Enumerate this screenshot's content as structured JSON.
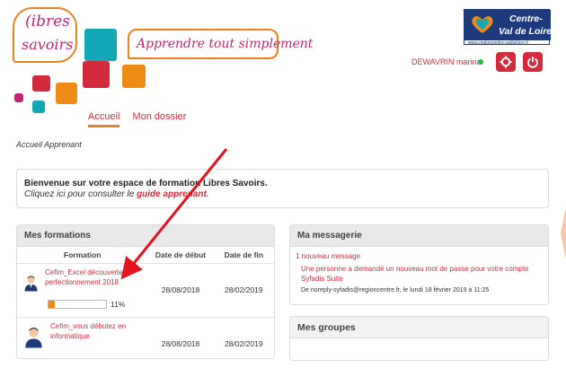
{
  "brand": {
    "logo_line1": "(ibres",
    "logo_line2": "savoirs",
    "tagline": "Apprendre tout simplement",
    "colors": {
      "accent": "#d42b3c",
      "orange": "#e8821e",
      "teal": "#11a7b4",
      "pink": "#c0266f",
      "navy": "#1d3a7a"
    }
  },
  "region_logo": {
    "line1": "Centre-",
    "line2": "Val de Loire",
    "url": "www.regioncentre-valdeloire.fr"
  },
  "nav": {
    "tabs": [
      {
        "label": "Accueil",
        "active": true
      },
      {
        "label": "Mon dossier",
        "active": false
      }
    ]
  },
  "user": {
    "name": "DEWAVRIN marina",
    "status": "online",
    "settings_icon": "gear-icon",
    "logout_icon": "power-icon"
  },
  "page": {
    "heading": "Accueil Apprenant"
  },
  "welcome": {
    "title": "Bienvenue sur votre espace de formation Libres Savoirs.",
    "text_before": "Cliquez ici pour consulter le ",
    "link": "guide apprenant",
    "text_after": "."
  },
  "formations": {
    "title": "Mes formations",
    "columns": [
      "Formation",
      "Date de début",
      "Date de fin"
    ],
    "rows": [
      {
        "title": "Cefim_Excel découverte et perfectionnement 2018",
        "start": "28/08/2018",
        "end": "28/02/2019",
        "progress": 11,
        "progress_label": "11%"
      },
      {
        "title": "Cefim_vous débutez en informatique",
        "start": "28/08/2018",
        "end": "28/02/2019"
      }
    ]
  },
  "messagerie": {
    "title": "Ma messagerie",
    "count": "1 nouveau message",
    "message": "Une personne a demandé un nouveau mot de passe pour votre compte Syfadis Suite",
    "meta": "De noreply-syfadis@regioncentre.fr, le lundi 18 février 2019 à 11:25"
  },
  "groupes": {
    "title": "Mes groupes"
  }
}
